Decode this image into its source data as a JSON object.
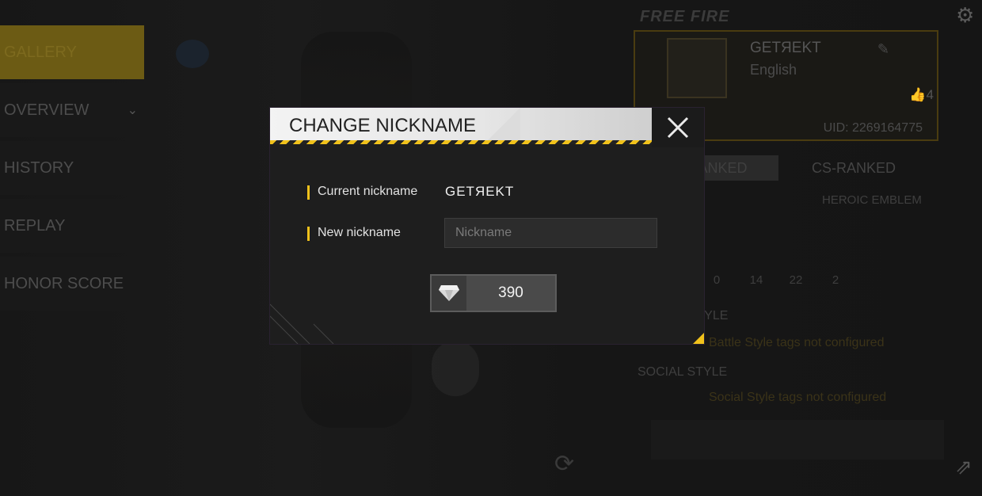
{
  "left_menu": {
    "items": [
      {
        "label": "GALLERY",
        "active": true
      },
      {
        "label": "OVERVIEW",
        "active": false,
        "has_chevron": true
      },
      {
        "label": "HISTORY",
        "active": false
      },
      {
        "label": "REPLAY",
        "active": false
      },
      {
        "label": "HONOR SCORE",
        "active": false
      }
    ]
  },
  "profile": {
    "logo": "FREE FIRE",
    "name": "GETЯEKT",
    "language": "English",
    "likes": "4",
    "uid": "UID: 2269164775",
    "tabs": [
      "BR-RANKED",
      "CS-RANKED"
    ],
    "emblem": "HEROIC EMBLEM",
    "stats": [
      "0",
      "14",
      "22",
      "2"
    ],
    "battle_style_title": "BATTLE STYLE",
    "battle_style_note": "Battle Style tags not configured",
    "social_style_title": "SOCIAL STYLE",
    "social_style_note": "Social Style tags not configured"
  },
  "modal": {
    "title": "CHANGE NICKNAME",
    "current_label": "Current nickname",
    "current_value": "GETЯEKT",
    "new_label": "New nickname",
    "input_placeholder": "Nickname",
    "input_value": "",
    "price": "390",
    "price_icon": "diamond-icon"
  },
  "colors": {
    "accent": "#f1c21b",
    "modal_bg": "#1e1e1e",
    "header_bg": "#f3f3f3"
  }
}
